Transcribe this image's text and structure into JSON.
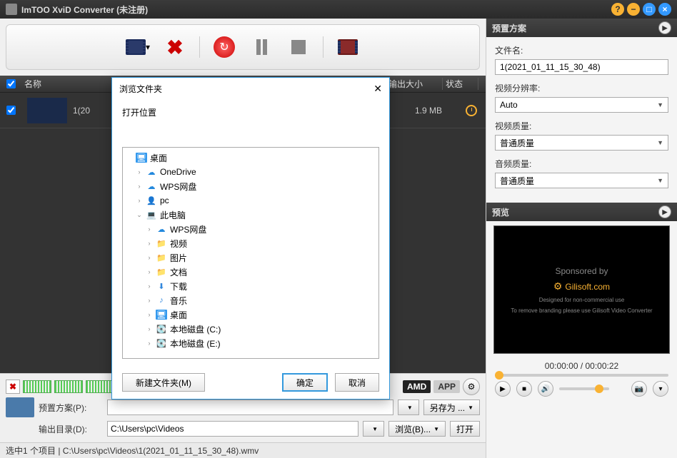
{
  "title": "ImTOO XviD Converter (未注册)",
  "toolbar": {
    "dropdown_arrow": "▾"
  },
  "list": {
    "headers": {
      "name": "名称",
      "outsize": "输出大小",
      "status": "状态"
    },
    "rows": [
      {
        "name": "1(20",
        "size": "1.9 MB"
      }
    ]
  },
  "amd_badge": "AMD",
  "app_badge": "APP",
  "preset_row": {
    "label": "预置方案(P):",
    "saveas": "另存为 ..."
  },
  "output_row": {
    "label": "输出目录(D):",
    "value": "C:\\Users\\pc\\Videos",
    "browse": "浏览(B)...",
    "open": "打开"
  },
  "statusbar": "选中1 个项目 | C:\\Users\\pc\\Videos\\1(2021_01_11_15_30_48).wmv",
  "right": {
    "preset_header": "预置方案",
    "filename_label": "文件名:",
    "filename_value": "1(2021_01_11_15_30_48)",
    "res_label": "视频分辨率:",
    "res_value": "Auto",
    "vq_label": "视频质量:",
    "vq_value": "普通质量",
    "aq_label": "音频质量:",
    "aq_value": "普通质量",
    "preview_header": "预览",
    "sponsor": "Sponsored by",
    "gilisoft": "Gilisoft.com",
    "preview_sub1": "Designed for non-commercial use",
    "preview_sub2": "To remove branding please use Gilisoft Video Converter",
    "time": "00:00:00 / 00:00:22"
  },
  "dialog": {
    "title": "浏览文件夹",
    "subtitle": "打开位置",
    "tree": [
      {
        "indent": 0,
        "exp": "",
        "icon": "desktop",
        "label": "桌面"
      },
      {
        "indent": 1,
        "exp": ">",
        "icon": "cloud",
        "label": "OneDrive"
      },
      {
        "indent": 1,
        "exp": ">",
        "icon": "cloud",
        "label": "WPS网盘"
      },
      {
        "indent": 1,
        "exp": ">",
        "icon": "user",
        "label": "pc"
      },
      {
        "indent": 1,
        "exp": "v",
        "icon": "pc",
        "label": "此电脑"
      },
      {
        "indent": 2,
        "exp": ">",
        "icon": "cloud",
        "label": "WPS网盘"
      },
      {
        "indent": 2,
        "exp": ">",
        "icon": "folder",
        "label": "视频"
      },
      {
        "indent": 2,
        "exp": ">",
        "icon": "folder",
        "label": "图片"
      },
      {
        "indent": 2,
        "exp": ">",
        "icon": "folder",
        "label": "文档"
      },
      {
        "indent": 2,
        "exp": ">",
        "icon": "down",
        "label": "下载"
      },
      {
        "indent": 2,
        "exp": ">",
        "icon": "music",
        "label": "音乐"
      },
      {
        "indent": 2,
        "exp": ">",
        "icon": "desktop",
        "label": "桌面"
      },
      {
        "indent": 2,
        "exp": ">",
        "icon": "disk",
        "label": "本地磁盘 (C:)"
      },
      {
        "indent": 2,
        "exp": ">",
        "icon": "disk",
        "label": "本地磁盘 (E:)"
      }
    ],
    "newfolder": "新建文件夹(M)",
    "ok": "确定",
    "cancel": "取消"
  }
}
